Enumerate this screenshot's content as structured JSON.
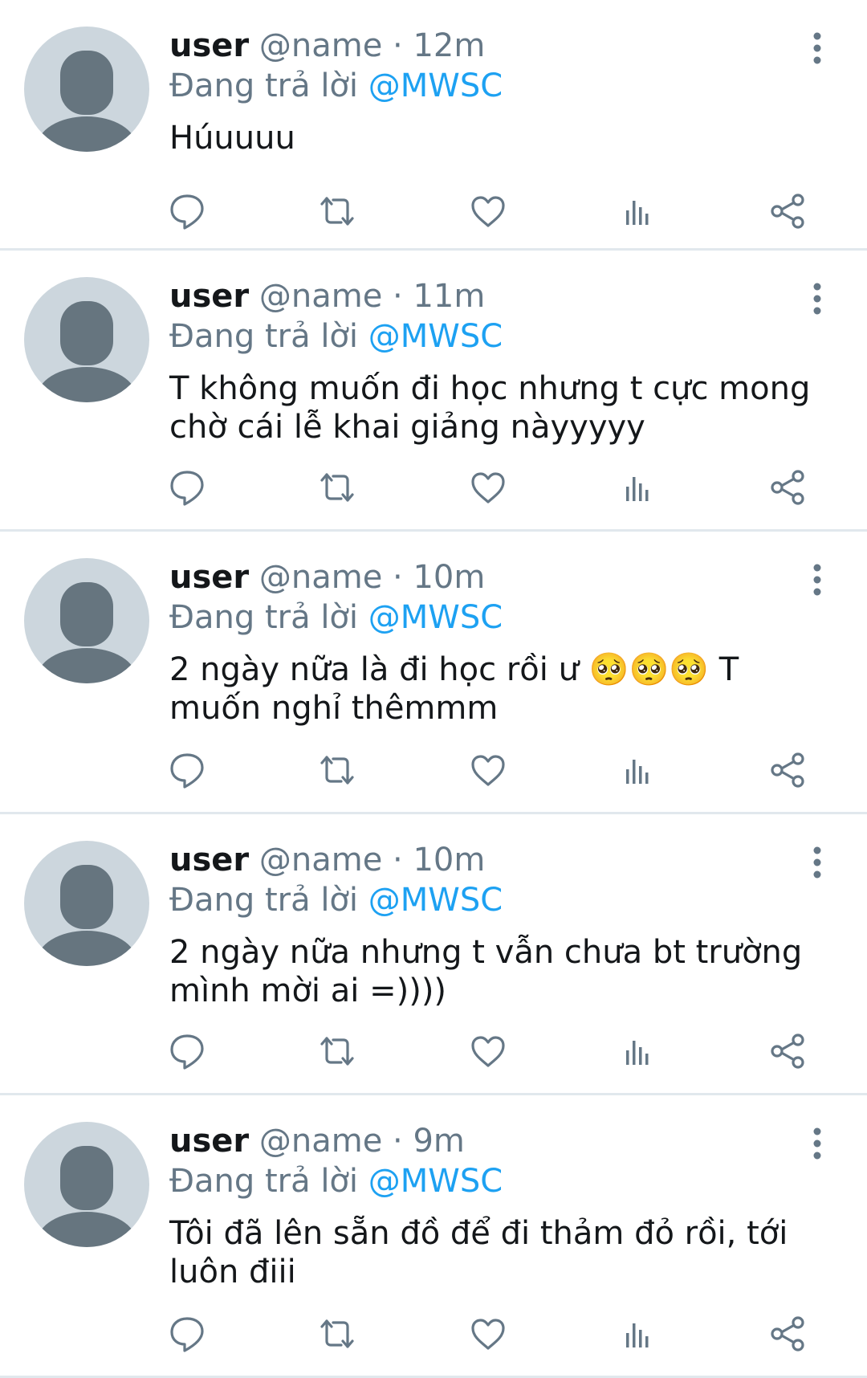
{
  "tweets": [
    {
      "display_name": "user",
      "handle": "@name",
      "separator": "·",
      "time": "12m",
      "replying_prefix": "Đang trả lời",
      "replying_to": "@MWSC",
      "text": "Húuuuu"
    },
    {
      "display_name": "user",
      "handle": "@name",
      "separator": "·",
      "time": "11m",
      "replying_prefix": "Đang trả lời",
      "replying_to": "@MWSC",
      "text": "T không muốn đi học nhưng t cực mong chờ cái lễ khai giảng nàyyyyy"
    },
    {
      "display_name": "user",
      "handle": "@name",
      "separator": "·",
      "time": "10m",
      "replying_prefix": "Đang trả lời",
      "replying_to": "@MWSC",
      "text": "2 ngày nữa là đi học rồi ư 🥺🥺🥺 T muốn nghỉ thêmmm"
    },
    {
      "display_name": "user",
      "handle": "@name",
      "separator": "·",
      "time": "10m",
      "replying_prefix": "Đang trả lời",
      "replying_to": "@MWSC",
      "text": "2 ngày nữa nhưng t vẫn chưa bt trường mình mời ai =))))"
    },
    {
      "display_name": "user",
      "handle": "@name",
      "separator": "·",
      "time": "9m",
      "replying_prefix": "Đang trả lời",
      "replying_to": "@MWSC",
      "text": "Tôi đã lên sẵn đồ để đi thảm đỏ rồi, tới luôn điii"
    }
  ],
  "icons": {
    "avatar": "default-profile-icon",
    "more": "more-vertical-icon",
    "reply": "reply-bubble-icon",
    "retweet": "retweet-icon",
    "like": "heart-icon",
    "analytics": "analytics-bars-icon",
    "share": "share-icon"
  },
  "colors": {
    "text": "#14171a",
    "muted": "#657786",
    "mention": "#1da1f2",
    "avatar_bg": "#ccd6dd",
    "avatar_fg": "#66757f",
    "divider": "#e1e8ed"
  }
}
